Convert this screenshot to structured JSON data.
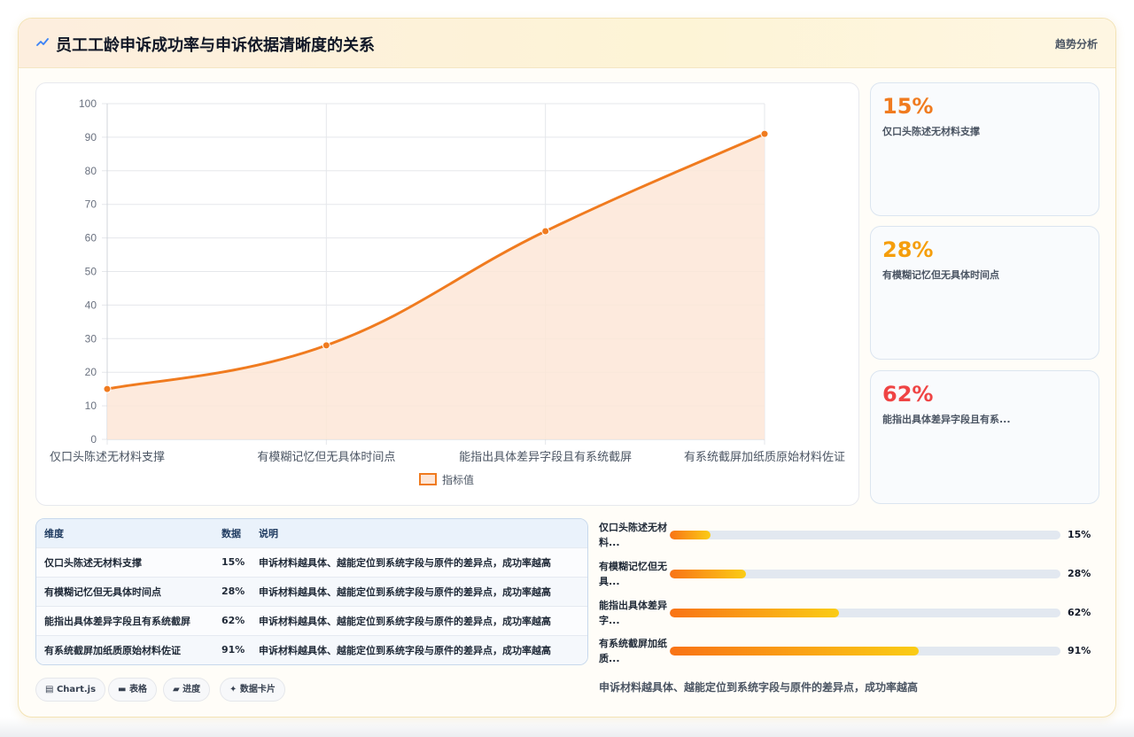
{
  "header": {
    "title": "员工工龄申诉成功率与申诉依据清晰度的关系",
    "tag": "趋势分析"
  },
  "chart_data": {
    "type": "area",
    "categories": [
      "仅口头陈述无材料支撑",
      "有模糊记忆但无具体时间点",
      "能指出具体差异字段且有系统截屏",
      "有系统截屏加纸质原始材料佐证"
    ],
    "series": [
      {
        "name": "指标值",
        "values": [
          15,
          28,
          62,
          91
        ]
      }
    ],
    "ylim": [
      0,
      100
    ],
    "yticks": [
      0,
      10,
      20,
      30,
      40,
      50,
      60,
      70,
      80,
      90,
      100
    ],
    "grid": true,
    "legend": "bottom",
    "colors": {
      "line": "#f07b1f",
      "fill": "#fde6d7"
    }
  },
  "stats": [
    {
      "value": "15%",
      "label": "仅口头陈述无材料支撑",
      "color": "#f07b1f"
    },
    {
      "value": "28%",
      "label": "有模糊记忆但无具体时间点",
      "color": "#f59e0b"
    },
    {
      "value": "62%",
      "label": "能指出具体差异字段且有系...",
      "color": "#ef4444"
    }
  ],
  "table": {
    "headers": [
      "维度",
      "数据",
      "说明"
    ],
    "rows": [
      [
        "仅口头陈述无材料支撑",
        "15%",
        "申诉材料越具体、越能定位到系统字段与原件的差异点，成功率越高"
      ],
      [
        "有模糊记忆但无具体时间点",
        "28%",
        "申诉材料越具体、越能定位到系统字段与原件的差异点，成功率越高"
      ],
      [
        "能指出具体差异字段且有系统截屏",
        "62%",
        "申诉材料越具体、越能定位到系统字段与原件的差异点，成功率越高"
      ],
      [
        "有系统截屏加纸质原始材料佐证",
        "91%",
        "申诉材料越具体、越能定位到系统字段与原件的差异点，成功率越高"
      ]
    ]
  },
  "chips": [
    "Chart.js",
    "表格",
    "进度",
    "数据卡片"
  ],
  "progress": [
    {
      "label": "仅口头陈述无材料...",
      "value": 15,
      "display": "15%"
    },
    {
      "label": "有模糊记忆但无具...",
      "value": 28,
      "display": "28%"
    },
    {
      "label": "能指出具体差异字...",
      "value": 62,
      "display": "62%"
    },
    {
      "label": "有系统截屏加纸质...",
      "value": 91,
      "display": "91%"
    }
  ],
  "summary": "申诉材料越具体、越能定位到系统字段与原件的差异点，成功率越高"
}
